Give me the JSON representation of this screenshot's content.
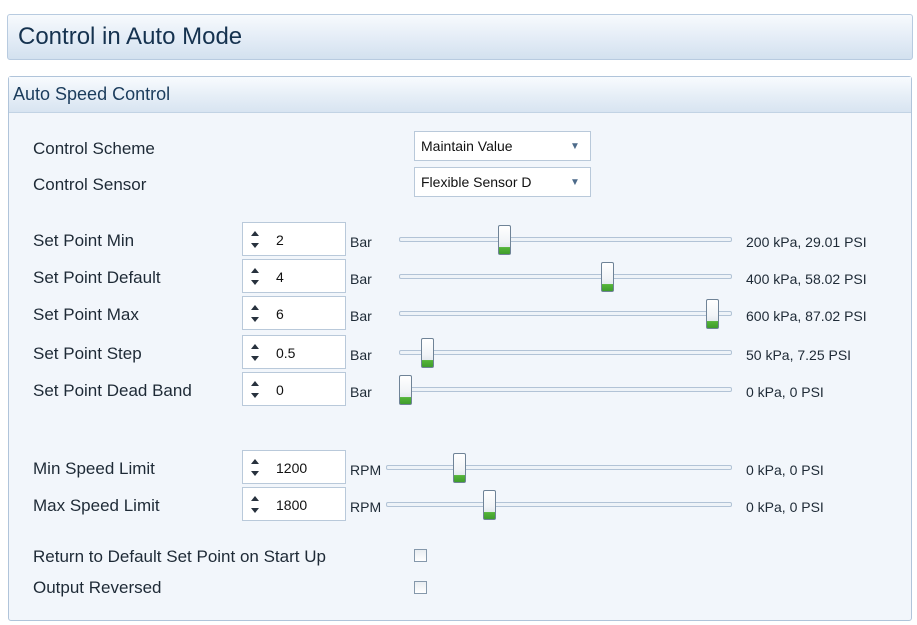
{
  "main_title": "Control in Auto Mode",
  "group_title": "Auto Speed Control",
  "dropdowns": [
    {
      "label": "Control Scheme",
      "value": "Maintain Value",
      "icon": "chevron-down-icon"
    },
    {
      "label": "Control Sensor",
      "value": "Flexible Sensor D",
      "icon": "chevron-down-icon"
    }
  ],
  "set_points": [
    {
      "label": "Set Point Min",
      "value": "2",
      "unit": "Bar",
      "readout": "200 kPa, 29.01 PSI",
      "slider_fraction": 0.31
    },
    {
      "label": "Set Point Default",
      "value": "4",
      "unit": "Bar",
      "readout": "400 kPa, 58.02 PSI",
      "slider_fraction": 0.63
    },
    {
      "label": "Set Point Max",
      "value": "6",
      "unit": "Bar",
      "readout": "600 kPa, 87.02 PSI",
      "slider_fraction": 0.96
    },
    {
      "label": "Set Point Step",
      "value": "0.5",
      "unit": "Bar",
      "readout": "50 kPa, 7.25 PSI",
      "slider_fraction": 0.07
    },
    {
      "label": "Set Point Dead Band",
      "value": "0",
      "unit": "Bar",
      "readout": "0 kPa, 0 PSI",
      "slider_fraction": 0.0
    }
  ],
  "speed_limits": [
    {
      "label": "Min Speed Limit",
      "value": "1200",
      "unit": "RPM",
      "readout": "0 kPa, 0 PSI",
      "slider_fraction": 0.2
    },
    {
      "label": "Max Speed Limit",
      "value": "1800",
      "unit": "RPM",
      "readout": "0 kPa, 0 PSI",
      "slider_fraction": 0.29
    }
  ],
  "checkboxes": [
    {
      "label": "Return to Default Set Point on Start Up",
      "checked": false
    },
    {
      "label": "Output Reversed",
      "checked": false
    }
  ],
  "colors": {
    "thumb_accent": "#4caf35",
    "header_text": "#15324f",
    "panel_bg": "#f2f6fb"
  }
}
